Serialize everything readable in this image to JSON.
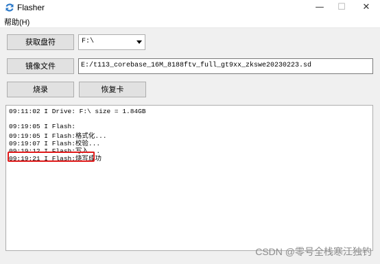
{
  "window": {
    "title": "Flasher",
    "minimize": "—",
    "maximize": "☐",
    "close": "✕"
  },
  "menu": {
    "help": "帮助(H)"
  },
  "buttons": {
    "get_drive": "获取盘符",
    "image_file": "镜像文件",
    "burn": "烧录",
    "restore_card": "恢复卡"
  },
  "drive_select": {
    "value": "F:\\"
  },
  "image_path": {
    "value": "E:/t113_corebase_16M_8188ftv_full_gt9xx_zkswe20230223.sd"
  },
  "log": {
    "lines": [
      "09:11:02 I Drive: F:\\ size = 1.84GB",
      "",
      "09:19:05 I Flash:",
      "09:19:05 I Flash:格式化...",
      "09:19:07 I Flash:校验...",
      "09:19:12 I Flash:写入...",
      "09:19:21 I Flash:烧写成功"
    ],
    "highlighted_index": 6,
    "highlight_color": "#e01818"
  },
  "watermark": "CSDN @零号全栈寒江独钓"
}
